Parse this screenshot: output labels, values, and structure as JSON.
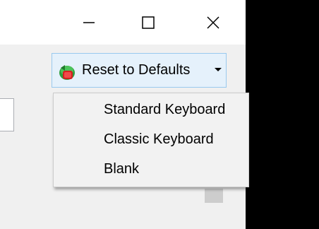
{
  "titlebar": {
    "minimize_icon": "minimize-icon",
    "maximize_icon": "maximize-icon",
    "close_icon": "close-icon"
  },
  "toolbar": {
    "reset_button": {
      "label": "Reset to Defaults",
      "icon": "reset-icon",
      "dropdown_icon": "chevron-down-icon"
    }
  },
  "menu": {
    "items": [
      {
        "label": "Standard Keyboard"
      },
      {
        "label": "Classic Keyboard"
      },
      {
        "label": "Blank"
      }
    ]
  },
  "colors": {
    "button_hover_bg": "#e5f1fb",
    "button_hover_border": "#99c9ef",
    "menu_bg": "#f2f2f2",
    "toolbar_bg": "#f0f0f0"
  }
}
